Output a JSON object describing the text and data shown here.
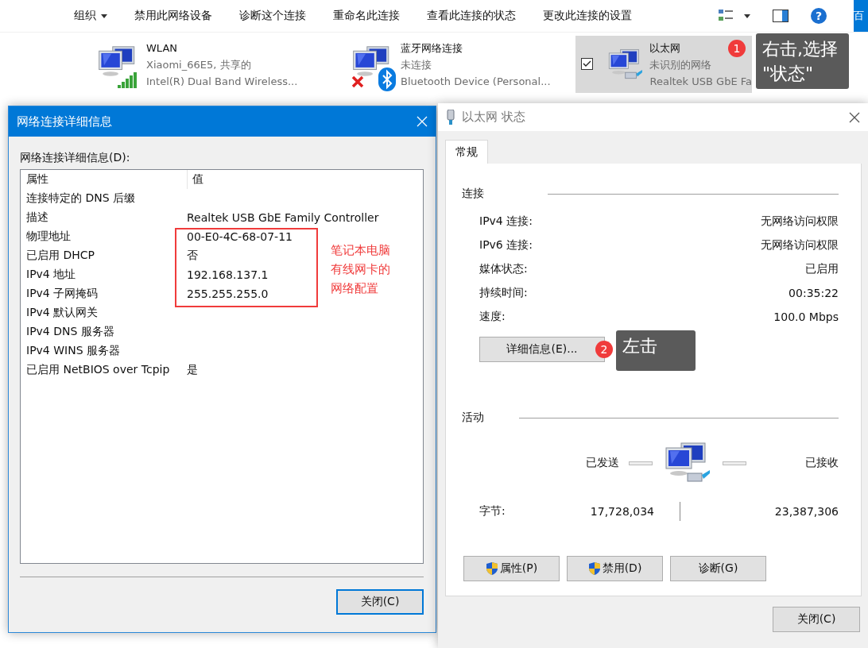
{
  "toolbar": {
    "items": [
      {
        "label": "组织",
        "dropdown": true
      },
      {
        "label": "禁用此网络设备",
        "dropdown": false
      },
      {
        "label": "诊断这个连接",
        "dropdown": false
      },
      {
        "label": "重命名此连接",
        "dropdown": false
      },
      {
        "label": "查看此连接的状态",
        "dropdown": false
      },
      {
        "label": "更改此连接的设置",
        "dropdown": false
      }
    ],
    "help": "?",
    "edge_tab": "百"
  },
  "connections": [
    {
      "name": "WLAN",
      "status": "Xiaomi_66E5, 共享的",
      "device": "Intel(R) Dual Band Wireless...",
      "kind": "wifi",
      "selected": false
    },
    {
      "name": "蓝牙网络连接",
      "status": "未连接",
      "device": "Bluetooth Device (Personal...",
      "kind": "bluetooth",
      "selected": false
    },
    {
      "name": "以太网",
      "status": "未识别的网络",
      "device": "Realtek USB GbE Fa",
      "kind": "ethernet",
      "selected": true
    }
  ],
  "callouts": [
    {
      "number": "1",
      "text": "右击,选择\n\"状态\""
    },
    {
      "number": "2",
      "text": "左击"
    }
  ],
  "details_dialog": {
    "title": "网络连接详细信息",
    "label": "网络连接详细信息(D):",
    "columns": [
      "属性",
      "值"
    ],
    "rows": [
      {
        "property": "连接特定的 DNS 后缀"
      },
      {
        "property": "描述",
        "value": "Realtek USB GbE Family Controller"
      },
      {
        "property": "物理地址",
        "value": "00-E0-4C-68-07-11"
      },
      {
        "property": "已启用 DHCP",
        "value": "否"
      },
      {
        "property": "IPv4 地址",
        "value": "192.168.137.1"
      },
      {
        "property": "IPv4 子网掩码",
        "value": "255.255.255.0"
      },
      {
        "property": "IPv4 默认网关"
      },
      {
        "property": "IPv4 DNS 服务器"
      },
      {
        "property": "IPv4 WINS 服务器"
      },
      {
        "property": "已启用 NetBIOS over Tcpip",
        "value": "是"
      }
    ],
    "note": "笔记本电脑有线网卡的网络配置",
    "close": {
      "label": "关闭(C)",
      "default": true
    }
  },
  "status_dialog": {
    "title": "以太网 状态",
    "tabs": [
      {
        "label": "常规",
        "selected": true
      }
    ],
    "connection_heading": "连接",
    "connection_rows": [
      {
        "label": "IPv4 连接:",
        "value": "无网络访问权限"
      },
      {
        "label": "IPv6 连接:",
        "value": "无网络访问权限"
      },
      {
        "label": "媒体状态:",
        "value": "已启用"
      },
      {
        "label": "持续时间:",
        "value": "00:35:22"
      },
      {
        "label": "速度:",
        "value": "100.0 Mbps"
      }
    ],
    "details_button": "详细信息(E)...",
    "activity_heading": "活动",
    "sent_label": "已发送",
    "received_label": "已接收",
    "bytes_label": "字节:",
    "bytes_sent": "17,728,034",
    "bytes_received": "23,387,306",
    "buttons": [
      {
        "label": "属性(P)",
        "kind": "shield"
      },
      {
        "label": "禁用(D)",
        "kind": "shield"
      },
      {
        "label": "诊断(G)",
        "kind": "plain"
      }
    ],
    "close": {
      "label": "关闭(C)",
      "default": false
    }
  }
}
